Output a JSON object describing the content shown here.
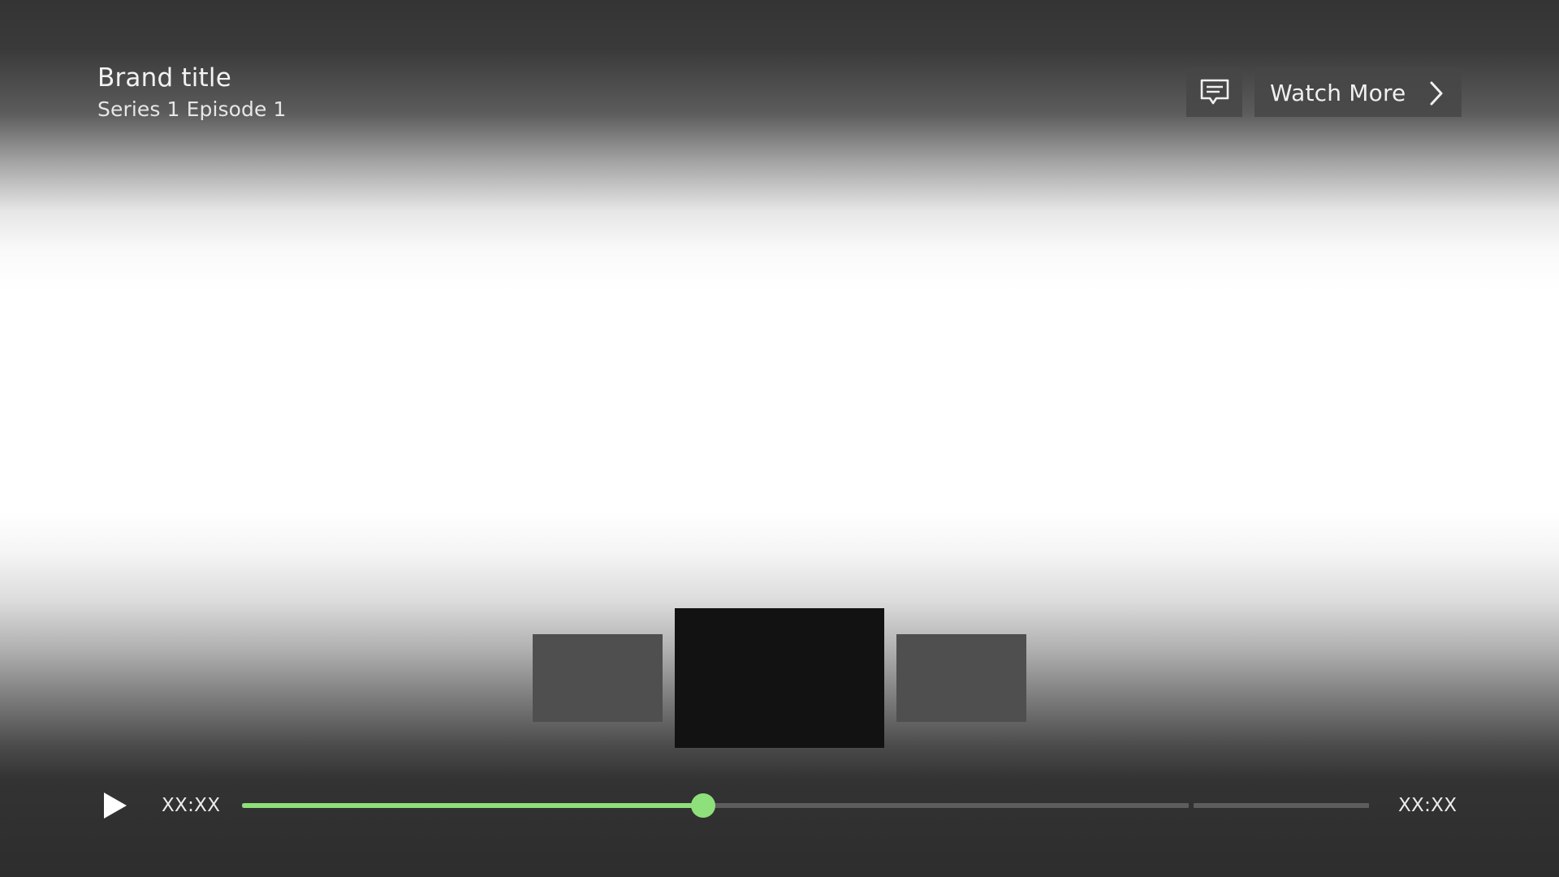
{
  "header": {
    "brand_title": "Brand title",
    "episode": "Series 1 Episode 1"
  },
  "actions": {
    "subtitles_icon": "subtitles-icon",
    "watch_more_label": "Watch More",
    "watch_more_icon": "chevron-right-icon"
  },
  "preview": {
    "thumbnails": [
      "previous-frame",
      "current-frame",
      "next-frame"
    ]
  },
  "player": {
    "play_icon": "play-icon",
    "current_time": "XX:XX",
    "total_time": "XX:XX",
    "progress_fraction": 0.409,
    "accent_color": "#8ee07a"
  }
}
